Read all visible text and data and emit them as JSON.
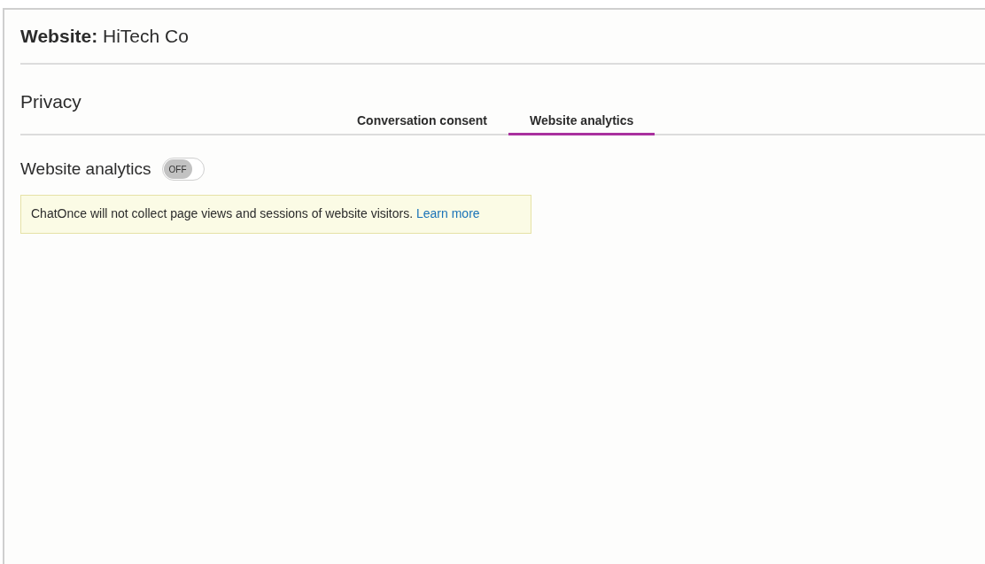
{
  "header": {
    "label": "Website:",
    "value": "HiTech Co"
  },
  "section_title": "Privacy",
  "tabs": [
    {
      "label": "Conversation consent",
      "selected": false
    },
    {
      "label": "Website analytics",
      "selected": true
    }
  ],
  "setting": {
    "label": "Website analytics",
    "on": false,
    "toggle_text": "OFF"
  },
  "notice": {
    "text": "ChatOnce will not collect page views and sessions of website visitors.",
    "link": "Learn more"
  }
}
